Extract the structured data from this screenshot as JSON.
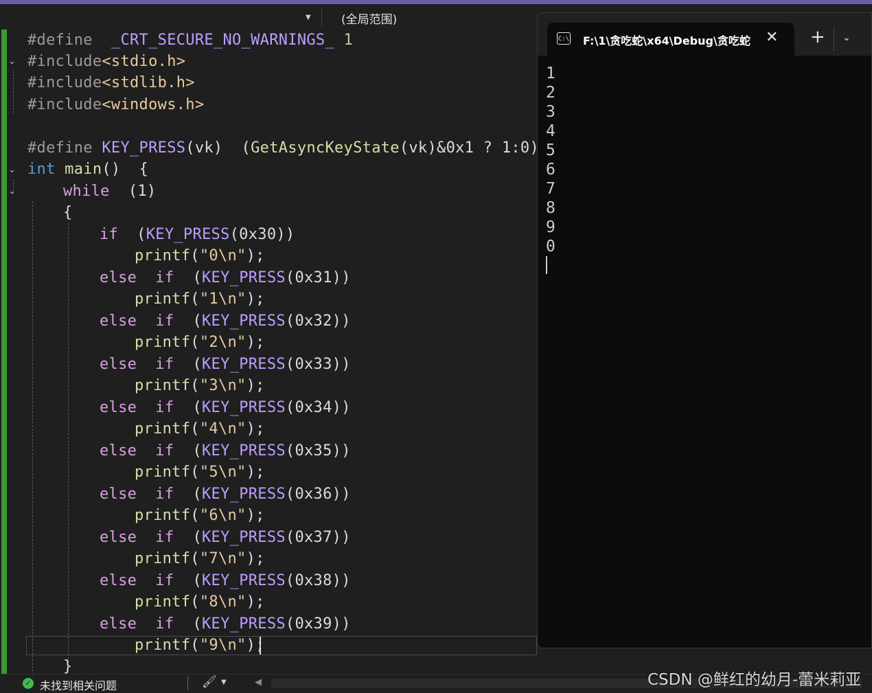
{
  "toolbar": {
    "scope_label": "(全局范围)"
  },
  "editor": {
    "lines": {
      "l1": {
        "pp": "#define",
        "sp": " ",
        "mac": "_CRT_SECURE_NO_WARNINGS_",
        "num": " 1"
      },
      "l2": {
        "pp": "#include",
        "inc": "<stdio.h>"
      },
      "l3": {
        "pp": "#include",
        "inc": "<stdlib.h>"
      },
      "l4": {
        "pp": "#include",
        "inc": "<windows.h>"
      },
      "l6": {
        "pp": "#define",
        "mac": " KEY_PRESS",
        "args": "(vk)  (",
        "fn": "GetAsyncKeyState",
        "rest": "(vk)&0x1 ? 1:0)"
      },
      "l7": {
        "kw": "int",
        "fn": " main",
        "rest": "()  {"
      },
      "l8": {
        "kw": "while",
        "rest": "  (1)"
      },
      "l9": {
        "rest": "{"
      },
      "if_kw": "if",
      "elseif_kw": "else  if",
      "macro": "KEY_PRESS",
      "printf": "printf",
      "branches": [
        {
          "code": "(0x30))",
          "str": "\"0\\n\""
        },
        {
          "code": "(0x31))",
          "str": "\"1\\n\""
        },
        {
          "code": "(0x32))",
          "str": "\"2\\n\""
        },
        {
          "code": "(0x33))",
          "str": "\"3\\n\""
        },
        {
          "code": "(0x34))",
          "str": "\"4\\n\""
        },
        {
          "code": "(0x35))",
          "str": "\"5\\n\""
        },
        {
          "code": "(0x36))",
          "str": "\"6\\n\""
        },
        {
          "code": "(0x37))",
          "str": "\"7\\n\""
        },
        {
          "code": "(0x38))",
          "str": "\"8\\n\""
        },
        {
          "code": "(0x39))",
          "str": "\"9\\n\""
        }
      ],
      "close_brace": "}"
    }
  },
  "terminal": {
    "title": "F:\\1\\贪吃蛇\\x64\\Debug\\贪吃蛇",
    "icon_text": "C:\\",
    "output": [
      "1",
      "2",
      "3",
      "4",
      "5",
      "6",
      "7",
      "8",
      "9",
      "0"
    ]
  },
  "statusbar": {
    "issues_text": "未找到相关问题"
  },
  "watermark": "CSDN @鲜红的幼月-蕾米莉亚"
}
